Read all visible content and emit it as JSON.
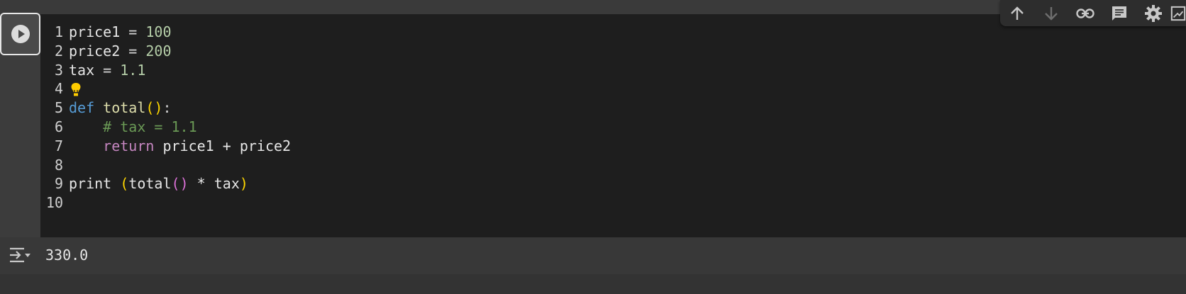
{
  "cell": {
    "lines": [
      {
        "number": "1",
        "tokens": [
          {
            "text": "price1",
            "cls": "tok-id"
          },
          {
            "text": " = ",
            "cls": "tok-op"
          },
          {
            "text": "100",
            "cls": "tok-num"
          }
        ]
      },
      {
        "number": "2",
        "tokens": [
          {
            "text": "price2",
            "cls": "tok-id"
          },
          {
            "text": " = ",
            "cls": "tok-op"
          },
          {
            "text": "200",
            "cls": "tok-num"
          }
        ]
      },
      {
        "number": "3",
        "tokens": [
          {
            "text": "tax",
            "cls": "tok-id"
          },
          {
            "text": " = ",
            "cls": "tok-op"
          },
          {
            "text": "1.1",
            "cls": "tok-num"
          }
        ]
      },
      {
        "number": "4",
        "tokens": [],
        "lightbulb": true
      },
      {
        "number": "5",
        "tokens": [
          {
            "text": "def",
            "cls": "tok-def"
          },
          {
            "text": " ",
            "cls": "tok-op"
          },
          {
            "text": "total",
            "cls": "tok-fn"
          },
          {
            "text": "()",
            "cls": "tok-paren"
          },
          {
            "text": ":",
            "cls": "tok-op"
          }
        ]
      },
      {
        "number": "6",
        "tokens": [
          {
            "text": "    ",
            "cls": "tok-op"
          },
          {
            "text": "# tax = 1.1",
            "cls": "tok-comment"
          }
        ]
      },
      {
        "number": "7",
        "tokens": [
          {
            "text": "    ",
            "cls": "tok-op"
          },
          {
            "text": "return",
            "cls": "tok-kw"
          },
          {
            "text": " price1 + price2",
            "cls": "tok-id"
          }
        ]
      },
      {
        "number": "8",
        "tokens": []
      },
      {
        "number": "9",
        "tokens": [
          {
            "text": "print",
            "cls": "tok-id"
          },
          {
            "text": " ",
            "cls": "tok-op"
          },
          {
            "text": "(",
            "cls": "tok-paren"
          },
          {
            "text": "total",
            "cls": "tok-id"
          },
          {
            "text": "()",
            "cls": "tok-paren2"
          },
          {
            "text": " * tax",
            "cls": "tok-id"
          },
          {
            "text": ")",
            "cls": "tok-paren"
          }
        ]
      },
      {
        "number": "10",
        "tokens": []
      }
    ]
  },
  "output": {
    "text": "330.0"
  },
  "toolbar": {
    "icons": [
      "arrow-up-icon",
      "arrow-down-icon",
      "link-icon",
      "comment-icon",
      "gear-icon",
      "mirror-cell-icon"
    ]
  },
  "icons": {
    "run": "play-circle-icon",
    "output": "output-options-icon",
    "hint": "lightbulb-icon"
  },
  "colors": {
    "editor_bg": "#1e1e1e",
    "number": "#b5cea8",
    "keyword_def": "#569cd6",
    "function": "#dcdcaa",
    "comment": "#6a9955",
    "keyword_return": "#c586c0",
    "bracket": "#ffd700"
  }
}
